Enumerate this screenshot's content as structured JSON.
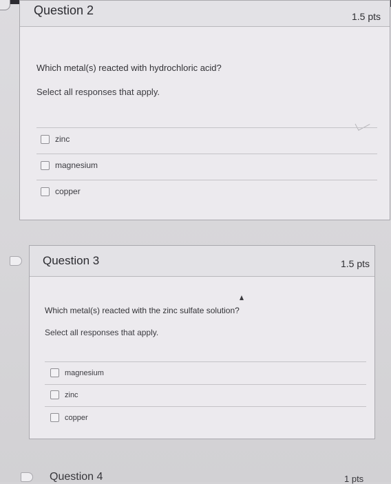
{
  "question2": {
    "title": "Question 2",
    "points": "1.5 pts",
    "prompt": "Which metal(s) reacted with hydrochloric acid?",
    "instruction": "Select all responses that apply.",
    "choices": [
      "zinc",
      "magnesium",
      "copper"
    ]
  },
  "question3": {
    "title": "Question 3",
    "points": "1.5 pts",
    "prompt": "Which metal(s) reacted with the zinc sulfate solution?",
    "instruction": "Select all responses that apply.",
    "choices": [
      "magnesium",
      "zinc",
      "copper"
    ]
  },
  "question4_peek": {
    "title": "Question 4",
    "points": "1 pts"
  },
  "icons": {
    "flag": "flag-icon",
    "pointer": "mouse-pointer-icon",
    "checkbox": "checkbox-icon"
  }
}
